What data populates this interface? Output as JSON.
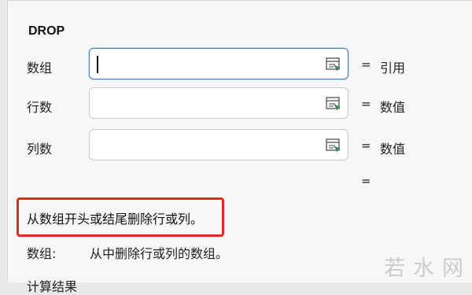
{
  "function": {
    "name": "DROP"
  },
  "args": [
    {
      "label": "数组",
      "result": "引用",
      "value": ""
    },
    {
      "label": "行数",
      "result": "数值",
      "value": ""
    },
    {
      "label": "列数",
      "result": "数值",
      "value": ""
    }
  ],
  "equals_sign": "=",
  "icons": {
    "ref_collapse": "collapse-dialog-icon"
  },
  "description": "从数组开头或结尾删除行或列。",
  "arg_help": {
    "label": "数组:",
    "text": "从中删除行或列的数组。"
  },
  "truncated_text": "计算结果",
  "watermark": "若水网",
  "colors": {
    "highlight": "#e12a1f",
    "focus_border": "#4f7fc0"
  }
}
